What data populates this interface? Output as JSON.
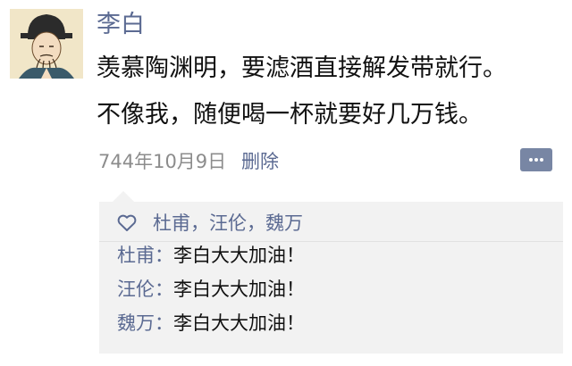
{
  "post": {
    "author": "李白",
    "lines": [
      "羡慕陶渊明，要滤酒直接解发带就行。",
      "不像我，随便喝一杯就要好几万钱。"
    ],
    "timestamp": "744年10月9日",
    "delete_label": "删除"
  },
  "social": {
    "likes_icon": "heart-outline-icon",
    "likers": "杜甫，汪伦，魏万",
    "comments": [
      {
        "name": "杜甫",
        "text": "李白大大加油！"
      },
      {
        "name": "汪伦",
        "text": "李白大大加油！"
      },
      {
        "name": "魏万",
        "text": "李白大大加油！"
      }
    ],
    "comment_separator": "："
  },
  "icons": {
    "avatar": "poet-portrait-avatar",
    "comment_button": "comment-dots-icon"
  },
  "colors": {
    "link_blue": "#5b6a92",
    "text": "#111111",
    "meta_gray": "#8c8c8c",
    "panel_bg": "#f2f2f2",
    "button_bg": "#7886a4"
  }
}
